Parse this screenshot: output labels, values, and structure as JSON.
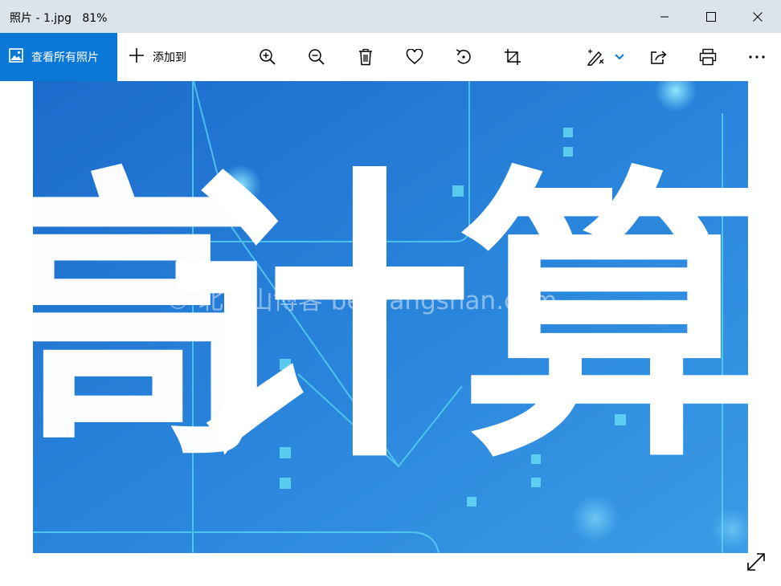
{
  "window": {
    "title": "照片 - 1.jpg   81%",
    "minimize_icon": "minimize-icon",
    "maximize_icon": "maximize-icon",
    "close_icon": "close-icon"
  },
  "toolbar": {
    "view_all_label": "查看所有照片",
    "add_to_label": "添加到",
    "icons": [
      "photos-icon",
      "plus-icon",
      "zoom-in-icon",
      "zoom-out-icon",
      "delete-icon",
      "heart-icon",
      "rotate-icon",
      "crop-icon",
      "edit-icon",
      "chevron-down-icon",
      "share-icon",
      "print-icon",
      "more-icon"
    ],
    "accent_color": "#0b78d7"
  },
  "photo": {
    "visible_text": "计算",
    "watermark": "© 北忘山博客 beiwangshan.com",
    "background_color": "#2a7fd4"
  },
  "viewer": {
    "expand_icon": "fullscreen-expand-icon"
  }
}
